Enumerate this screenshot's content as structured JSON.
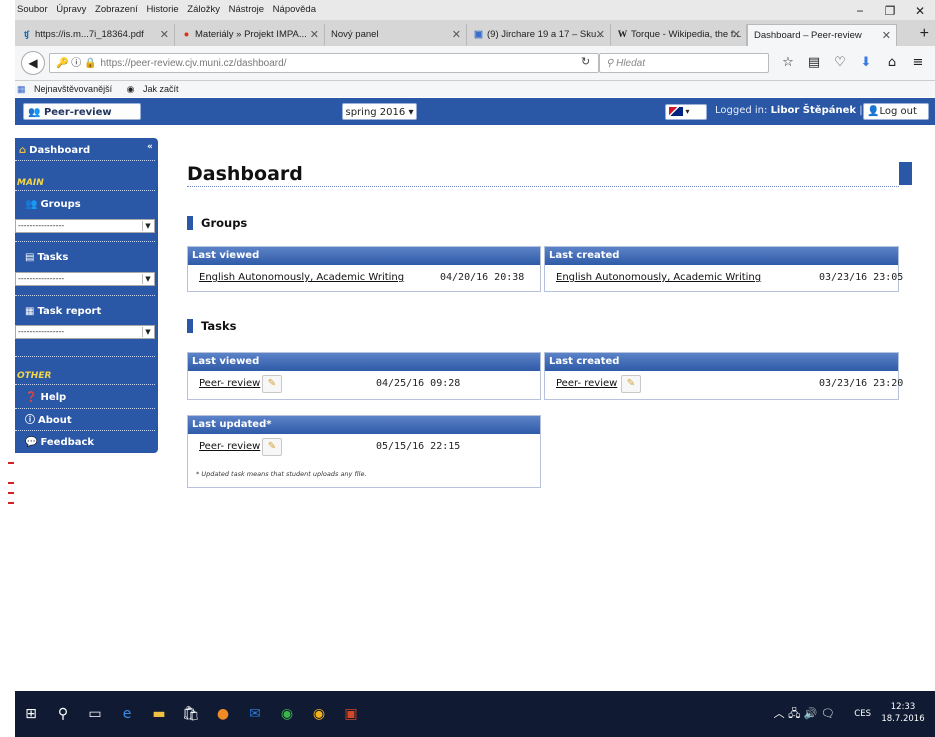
{
  "browser": {
    "menu": [
      "Soubor",
      "Úpravy",
      "Zobrazení",
      "Historie",
      "Záložky",
      "Nástroje",
      "Nápověda"
    ],
    "window_controls": [
      "−",
      "❐",
      "✕"
    ],
    "tabs": [
      {
        "label": "https://is.m...7i_18364.pdf",
        "icon": "is-favicon-icon"
      },
      {
        "label": "Materiály » Projekt IMPA...",
        "icon": "impa-favicon-icon"
      },
      {
        "label": "Nový panel",
        "icon": ""
      },
      {
        "label": "(9) Jirchare 19 a 17 – Sku...",
        "icon": "chat-favicon-icon"
      },
      {
        "label": "Torque - Wikipedia, the f...",
        "icon": "wikipedia-favicon-icon"
      },
      {
        "label": "Dashboard – Peer-review",
        "icon": ""
      }
    ],
    "url": "https://peer-review.cjv.muni.cz/dashboard/",
    "search_placeholder": "Hledat",
    "bookmarks": [
      "Nejnavštěvovanější",
      "Jak začít"
    ]
  },
  "header": {
    "brand": "Peer-review",
    "semester": "spring 2016",
    "logged_in_label": "Logged in:",
    "user_name": "Libor Štěpánek",
    "separator": "|",
    "logout": "Log out"
  },
  "sidebar": {
    "dashboard": "Dashboard",
    "collapse": "«",
    "main_section": "MAIN",
    "groups": "Groups",
    "groups_select": "----------------",
    "tasks": "Tasks",
    "tasks_select": "----------------",
    "task_report": "Task report",
    "task_report_select": "----------------",
    "other_section": "OTHER",
    "help": "Help",
    "about": "About",
    "feedback": "Feedback"
  },
  "main": {
    "title": "Dashboard",
    "groups_title": "Groups",
    "tasks_title": "Tasks",
    "groups_last_viewed": {
      "header": "Last viewed",
      "link": "English Autonomously, Academic Writing",
      "date": "04/20/16 20:38"
    },
    "groups_last_created": {
      "header": "Last created",
      "link": "English Autonomously, Academic Writing",
      "date": "03/23/16 23:05"
    },
    "tasks_last_viewed": {
      "header": "Last viewed",
      "link": "Peer- review",
      "date": "04/25/16 09:28"
    },
    "tasks_last_created": {
      "header": "Last created",
      "link": "Peer- review",
      "date": "03/23/16 23:20"
    },
    "tasks_last_updated": {
      "header": "Last updated*",
      "link": "Peer- review",
      "date": "05/15/16 22:15",
      "note": "* Updated task means that student uploads any file."
    }
  },
  "taskbar": {
    "lang": "CES",
    "time": "12:33",
    "date": "18.7.2016"
  },
  "colors": {
    "accent": "#2a57a6",
    "section_label": "#f3d64b"
  }
}
